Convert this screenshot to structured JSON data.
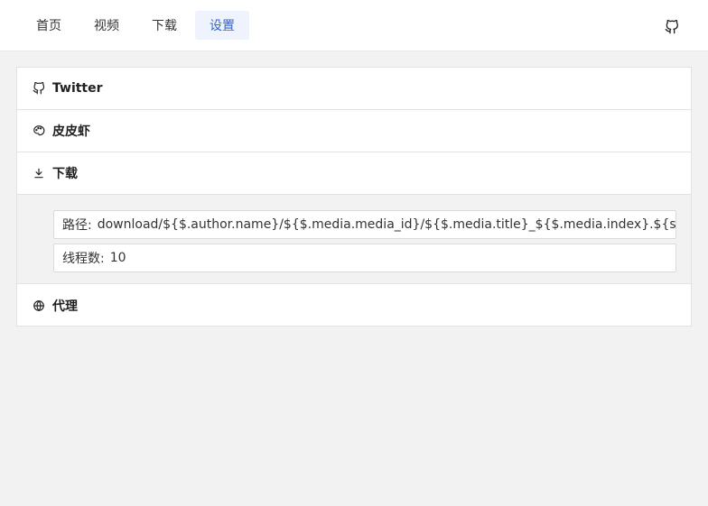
{
  "nav": {
    "tabs": [
      {
        "label": "首页"
      },
      {
        "label": "视频"
      },
      {
        "label": "下载"
      },
      {
        "label": "设置",
        "active": true
      }
    ],
    "github_icon": "github-icon"
  },
  "sections": {
    "twitter": {
      "title": "Twitter",
      "icon": "github-icon"
    },
    "pipixia": {
      "title": "皮皮虾",
      "icon": "palette-icon"
    },
    "download": {
      "title": "下载",
      "icon": "download-icon",
      "path_label": "路径:",
      "path_value": "download/${$.author.name}/${$.media.media_id}/${$.media.title}_${$.media.index}.${suffix}",
      "threads_label": "线程数:",
      "threads_value": "10"
    },
    "proxy": {
      "title": "代理",
      "icon": "globe-icon"
    }
  },
  "colors": {
    "accent": "#2f64d6",
    "active_tab_bg": "#eef3fd",
    "page_bg": "#f2f2f2"
  }
}
